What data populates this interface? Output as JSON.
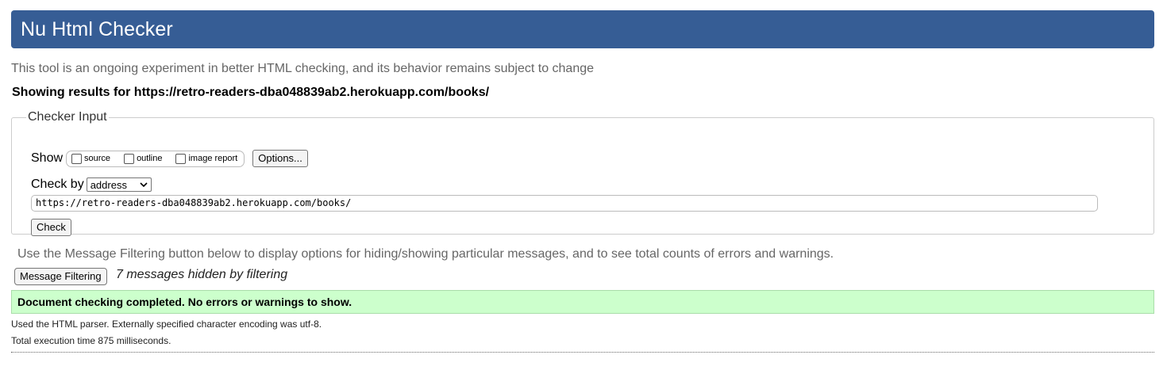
{
  "header": {
    "title": "Nu Html Checker"
  },
  "intro": "This tool is an ongoing experiment in better HTML checking, and its behavior remains subject to change",
  "results_for": "Showing results for https://retro-readers-dba048839ab2.herokuapp.com/books/",
  "checker": {
    "legend": "Checker Input",
    "show_label": "Show",
    "options": [
      {
        "label": "source",
        "checked": false
      },
      {
        "label": "outline",
        "checked": false
      },
      {
        "label": "image report",
        "checked": false
      }
    ],
    "options_button": "Options...",
    "check_by_label": "Check by",
    "check_by_value": "address",
    "url_value": "https://retro-readers-dba048839ab2.herokuapp.com/books/",
    "check_button": "Check"
  },
  "filter": {
    "hint": "Use the Message Filtering button below to display options for hiding/showing particular messages, and to see total counts of errors and warnings.",
    "button": "Message Filtering",
    "hidden_count": "7 messages hidden by filtering"
  },
  "result": {
    "success": "Document checking completed. No errors or warnings to show.",
    "parser": "Used the HTML parser. Externally specified character encoding was utf-8.",
    "time": "Total execution time 875 milliseconds."
  },
  "colors": {
    "header_bg": "#365d95",
    "success_bg": "#ccffcc"
  }
}
